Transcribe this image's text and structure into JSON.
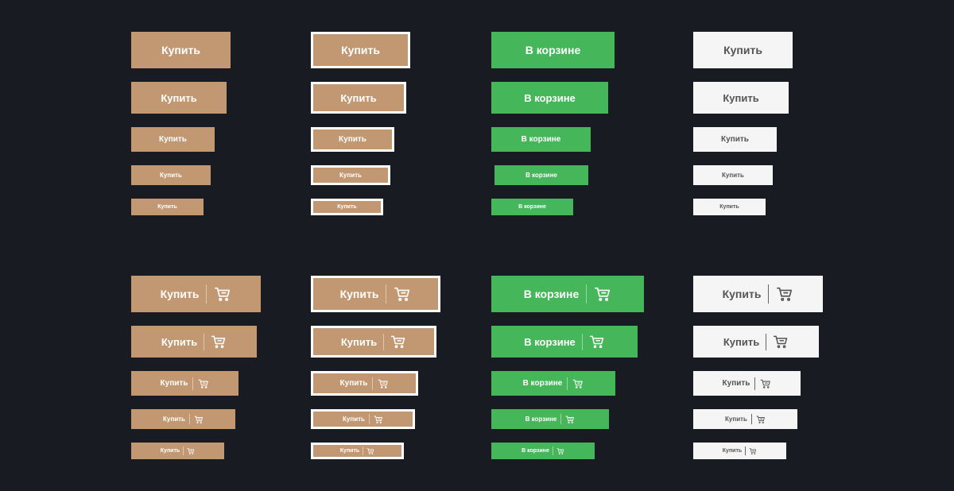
{
  "rows": [
    {
      "buttons": [
        {
          "variant": "primary",
          "label": "Купить"
        },
        {
          "variant": "outline",
          "label": "Купить"
        },
        {
          "variant": "green",
          "label": "В корзине"
        },
        {
          "variant": "white",
          "label": "Купить"
        }
      ]
    },
    {
      "buttons": [
        {
          "variant": "primary",
          "label": "Купить",
          "icon": "cart-icon"
        },
        {
          "variant": "outline",
          "label": "Купить",
          "icon": "cart-icon"
        },
        {
          "variant": "green",
          "label": "В корзине",
          "icon": "cart-icon"
        },
        {
          "variant": "white",
          "label": "Купить",
          "icon": "cart-icon"
        }
      ]
    }
  ],
  "colors": {
    "background": "#181b22",
    "primary": "#c29873",
    "green": "#46b65a",
    "white_button": "#f5f5f5",
    "white_button_text": "#555555"
  }
}
